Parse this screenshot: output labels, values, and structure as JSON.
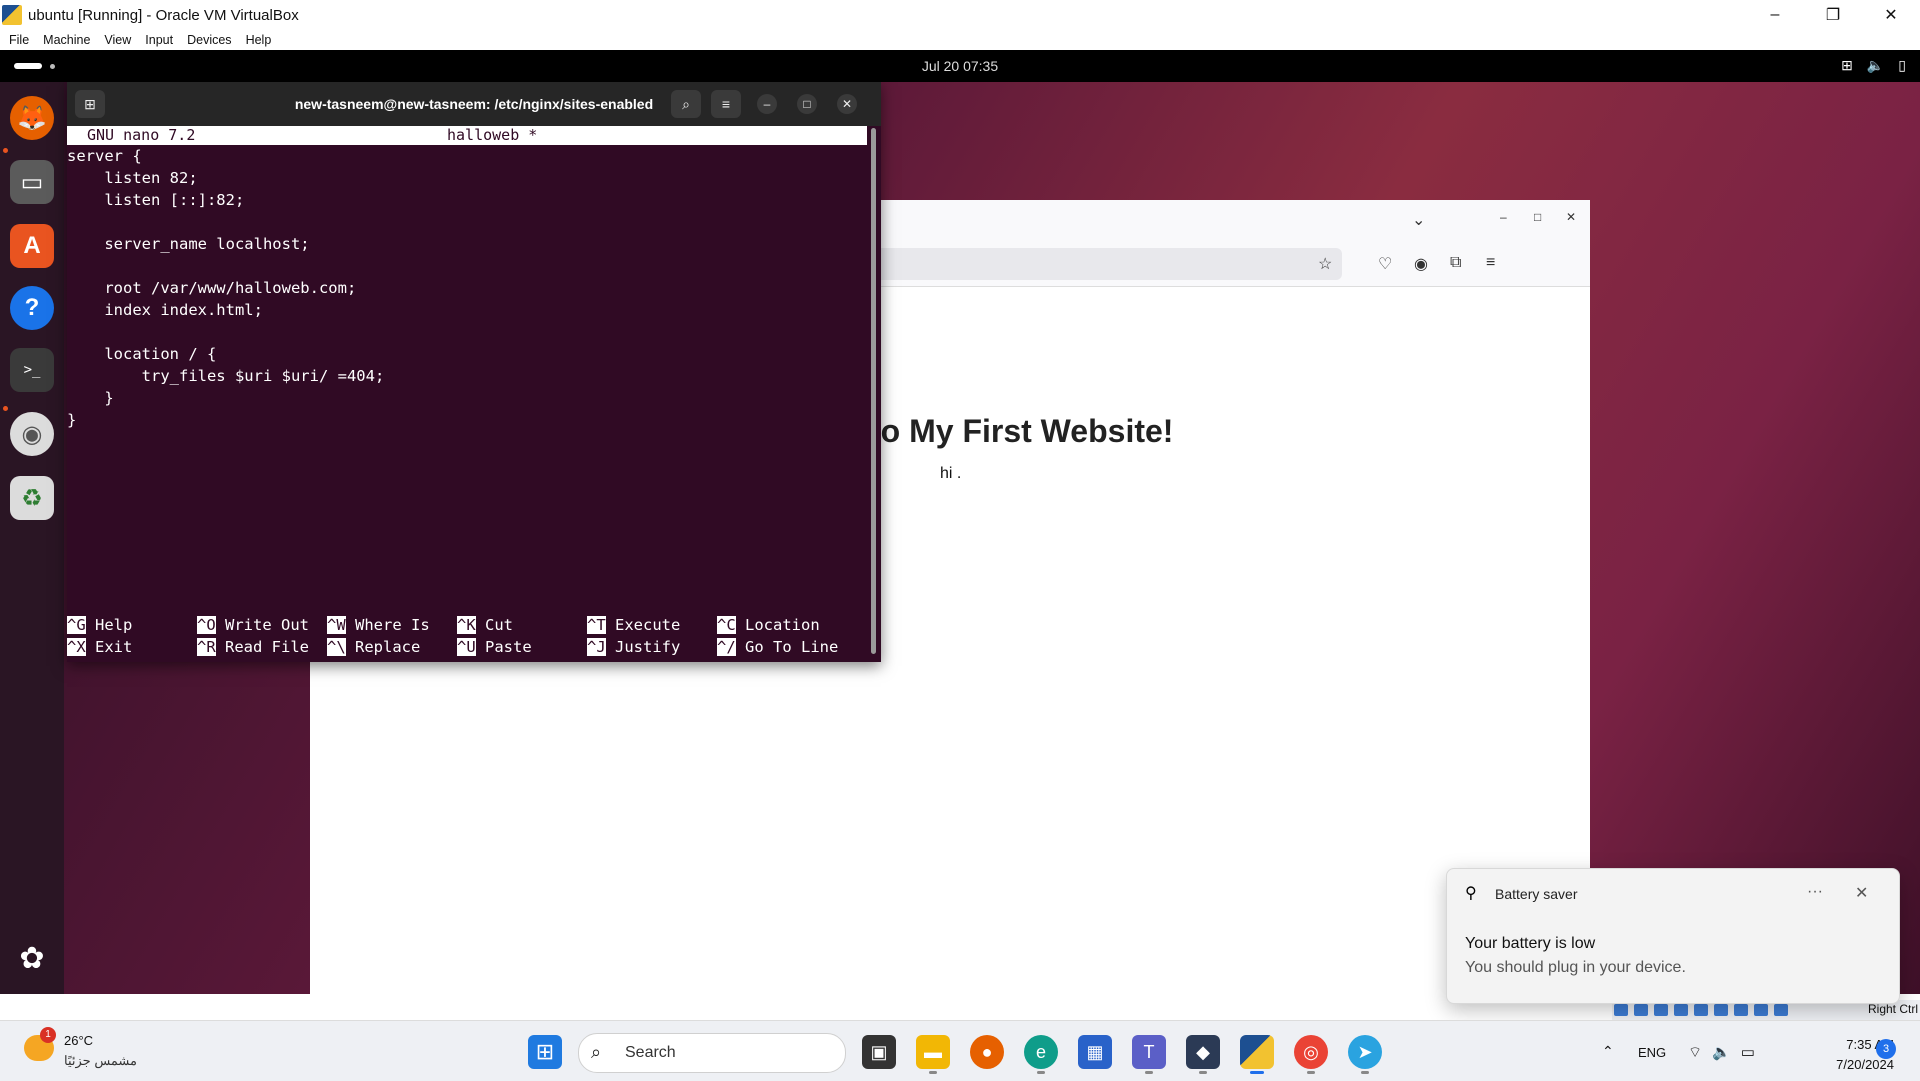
{
  "host": {
    "window_title": "ubuntu [Running] - Oracle VM VirtualBox",
    "menu": [
      "File",
      "Machine",
      "View",
      "Input",
      "Devices",
      "Help"
    ],
    "win_controls": {
      "minimize": "–",
      "restore": "❐",
      "close": "✕"
    },
    "status_right": "Right Ctrl"
  },
  "guest": {
    "clock": "Jul 20  07:35",
    "dock": [
      {
        "name": "firefox",
        "color": "#e66000",
        "glyph": "🦊"
      },
      {
        "name": "files",
        "color": "#555",
        "glyph": "▭"
      },
      {
        "name": "app-center",
        "color": "#e95420",
        "glyph": "A"
      },
      {
        "name": "help",
        "color": "#1a73e8",
        "glyph": "?"
      },
      {
        "name": "terminal",
        "color": "#2b2b2b",
        "glyph": ">_"
      },
      {
        "name": "disc",
        "color": "#dcdcdc",
        "glyph": "◉"
      },
      {
        "name": "trash",
        "color": "#dcdcdc",
        "glyph": "♻"
      }
    ]
  },
  "terminal": {
    "title": "new-tasneem@new-tasneem: /etc/nginx/sites-enabled",
    "nano_version": "GNU nano 7.2",
    "filename": "halloweb *",
    "content": "server {\n    listen 82;\n    listen [::]:82;\n\n    server_name localhost;\n\n    root /var/www/halloweb.com;\n    index index.html;\n\n    location / {\n        try_files $uri $uri/ =404;\n    }\n}",
    "shortcuts": [
      {
        "key": "^G",
        "label": "Help"
      },
      {
        "key": "^X",
        "label": "Exit"
      },
      {
        "key": "^O",
        "label": "Write Out"
      },
      {
        "key": "^R",
        "label": "Read File"
      },
      {
        "key": "^W",
        "label": "Where Is"
      },
      {
        "key": "^\\",
        "label": "Replace"
      },
      {
        "key": "^K",
        "label": "Cut"
      },
      {
        "key": "^U",
        "label": "Paste"
      },
      {
        "key": "^T",
        "label": "Execute"
      },
      {
        "key": "^J",
        "label": "Justify"
      },
      {
        "key": "^C",
        "label": "Location"
      },
      {
        "key": "^/",
        "label": "Go To Line"
      }
    ]
  },
  "browser": {
    "heading": "to My First Website!",
    "paragraph": "hi ."
  },
  "notification": {
    "app": "Battery saver",
    "title": "Your battery is low",
    "message": "You should plug in your device."
  },
  "taskbar": {
    "weather_temp": "26°C",
    "weather_cond": "مشمس جزئيًا",
    "weather_badge": "1",
    "search_label": "Search",
    "lang": "ENG",
    "time": "7:35 AM",
    "date": "7/20/2024",
    "notif_count": "3"
  }
}
